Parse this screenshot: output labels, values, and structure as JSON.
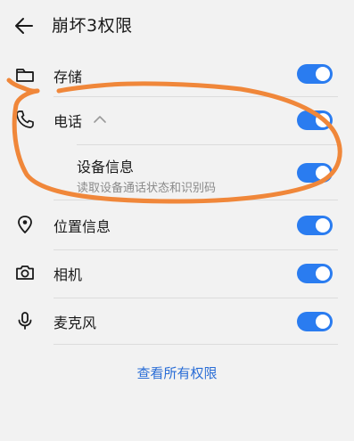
{
  "header": {
    "back_icon": "arrow-left-icon",
    "title": "崩坏3权限"
  },
  "permissions": [
    {
      "icon": "folder-icon",
      "label": "存储",
      "enabled": true
    },
    {
      "icon": "phone-icon",
      "label": "电话",
      "enabled": true,
      "expanded": true,
      "sub": {
        "label": "设备信息",
        "description": "读取设备通话状态和识别码",
        "enabled": true
      }
    },
    {
      "icon": "location-pin-icon",
      "label": "位置信息",
      "enabled": true
    },
    {
      "icon": "camera-icon",
      "label": "相机",
      "enabled": true
    },
    {
      "icon": "microphone-icon",
      "label": "麦克风",
      "enabled": true
    }
  ],
  "footer": {
    "view_all_label": "查看所有权限"
  },
  "colors": {
    "accent": "#2a7cf0",
    "link": "#2a6dd6",
    "annotation": "#f0873a",
    "background": "#f2f2f2"
  }
}
